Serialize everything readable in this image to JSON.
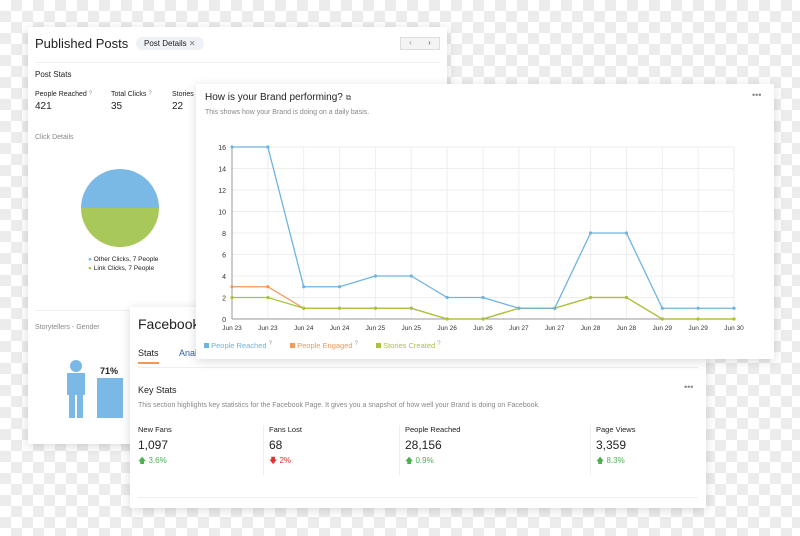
{
  "posts": {
    "title": "Published Posts",
    "chip": "Post Details",
    "section": "Post Stats",
    "stats": [
      {
        "label": "People Reached",
        "value": "421"
      },
      {
        "label": "Total Clicks",
        "value": "35"
      },
      {
        "label": "Stories",
        "value": "22"
      }
    ],
    "click_details": "Click Details",
    "pie": {
      "slices": [
        {
          "label": "Other Clicks, 7 People",
          "value": 7,
          "color": "#7ab8e6"
        },
        {
          "label": "Link Clicks, 7 People",
          "value": 7,
          "color": "#a8c95a"
        }
      ]
    },
    "gender_title": "Storytellers - Gender",
    "gender_pct": "71%"
  },
  "facebook": {
    "title": "Facebook",
    "tabs": [
      "Stats",
      "Analytics"
    ],
    "key_title": "Key Stats",
    "key_desc": "This section highlights key statistics for the Facebook Page. It gives you a snapshot of how well your Brand is doing on Facebook.",
    "stats": [
      {
        "label": "New Fans",
        "value": "1,097",
        "change": "3.6%",
        "dir": "up"
      },
      {
        "label": "Fans Lost",
        "value": "68",
        "change": "2%",
        "dir": "down"
      },
      {
        "label": "People Reached",
        "value": "28,156",
        "change": "0.9%",
        "dir": "up"
      },
      {
        "label": "Page Views",
        "value": "3,359",
        "change": "8.3%",
        "dir": "up"
      }
    ]
  },
  "chart_card": {
    "title": "How is your Brand performing?",
    "subtitle": "This shows how your Brand is doing on a daily basis."
  },
  "chart_data": {
    "type": "line",
    "x": [
      "Jun 23",
      "Jun 23",
      "Jun 24",
      "Jun 24",
      "Jun 25",
      "Jun 25",
      "Jun 26",
      "Jun 26",
      "Jun 27",
      "Jun 27",
      "Jun 28",
      "Jun 28",
      "Jun 29",
      "Jun 29",
      "Jun 30"
    ],
    "ylim": [
      0,
      16
    ],
    "yticks": [
      0,
      2,
      4,
      6,
      8,
      10,
      12,
      14,
      16
    ],
    "grid": true,
    "legend": "bottom-left",
    "series": [
      {
        "name": "People Reached",
        "color": "#6fb3e0",
        "values": [
          16,
          16,
          3,
          3,
          4,
          4,
          2,
          2,
          1,
          1,
          8,
          8,
          1,
          1,
          1
        ]
      },
      {
        "name": "People Engaged",
        "color": "#f0995a",
        "values": [
          3,
          3,
          1,
          1,
          1,
          1,
          0,
          0,
          1,
          1,
          2,
          2,
          0,
          0,
          0
        ]
      },
      {
        "name": "Stories Created",
        "color": "#a8c43e",
        "values": [
          2,
          2,
          1,
          1,
          1,
          1,
          0,
          0,
          1,
          1,
          2,
          2,
          0,
          0,
          0
        ]
      }
    ]
  }
}
